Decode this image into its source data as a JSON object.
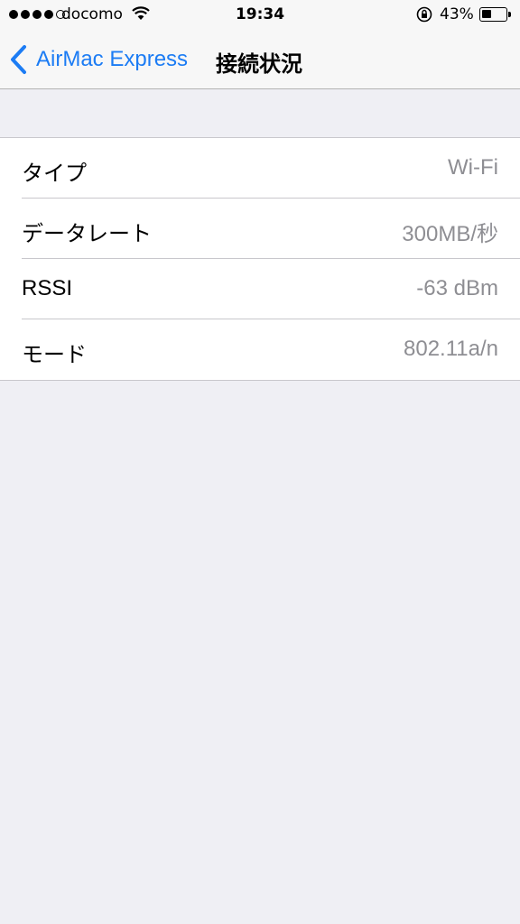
{
  "status_bar": {
    "carrier": "docomo",
    "time": "19:34",
    "battery_percent": "43%",
    "battery_level": 0.43,
    "signal_strength": "4 of 5"
  },
  "nav": {
    "back_label": "AirMac Express",
    "title": "接続状況"
  },
  "rows": [
    {
      "label": "タイプ",
      "value": "Wi-Fi"
    },
    {
      "label": "データレート",
      "value": "300MB/秒"
    },
    {
      "label": "RSSI",
      "value": "-63 dBm"
    },
    {
      "label": "モード",
      "value": "802.11a/n"
    }
  ],
  "colors": {
    "accent": "#1c7cf4",
    "background": "#efeff4",
    "value_text": "#8e8e93"
  }
}
